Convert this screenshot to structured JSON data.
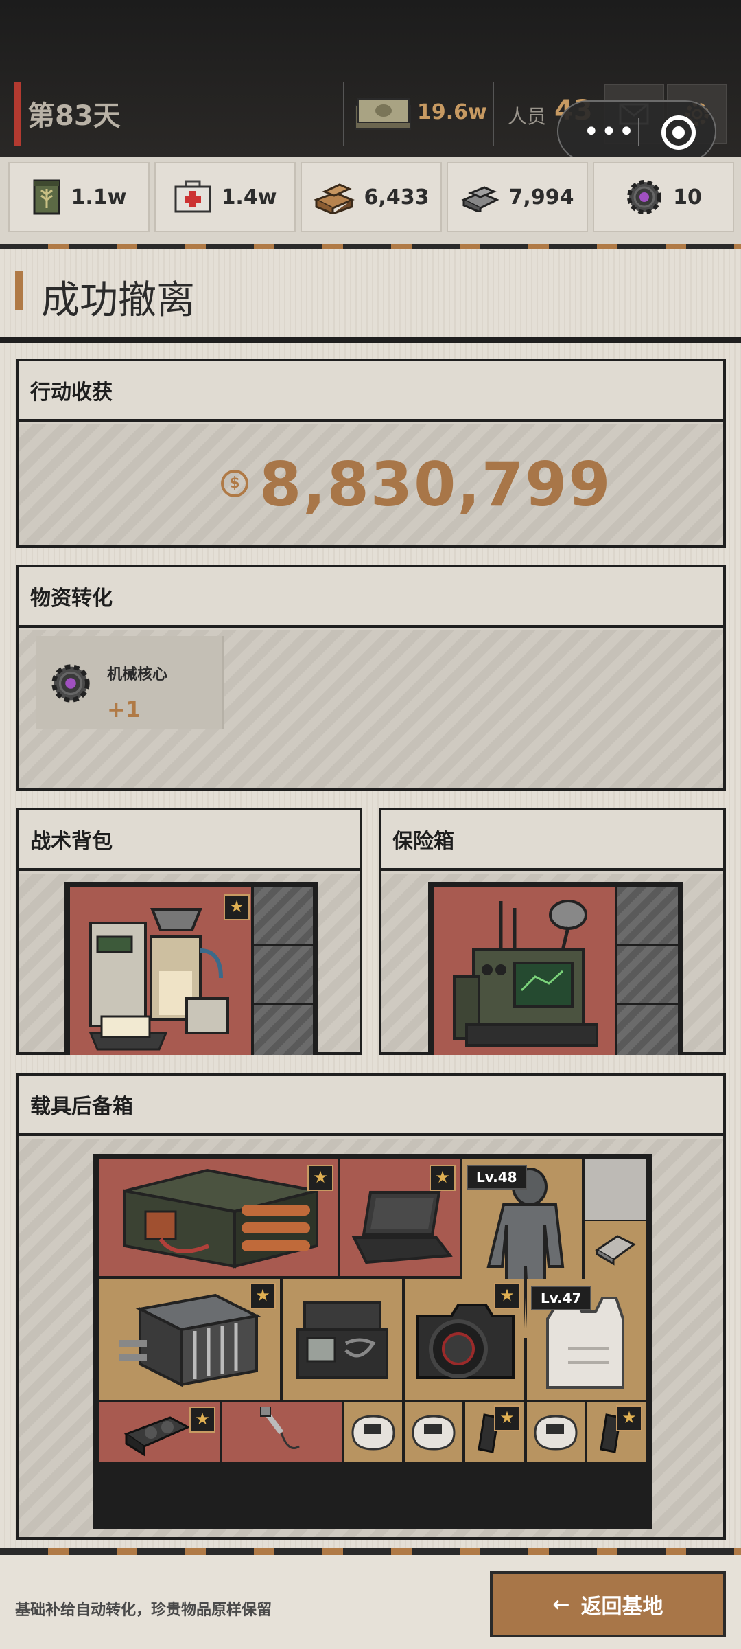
{
  "header": {
    "day": "第83天",
    "money": "19.6w",
    "staff_label": "人员",
    "staff_count": "43"
  },
  "resources": [
    {
      "icon": "grain-can-icon",
      "value": "1.1w"
    },
    {
      "icon": "medkit-icon",
      "value": "1.4w"
    },
    {
      "icon": "wood-planks-icon",
      "value": "6,433"
    },
    {
      "icon": "steel-bars-icon",
      "value": "7,994"
    },
    {
      "icon": "mech-core-icon",
      "value": "10"
    }
  ],
  "page_title": "成功撤离",
  "earnings": {
    "title": "行动收获",
    "currency_symbol": "$",
    "amount": "8,830,799"
  },
  "conversion": {
    "title": "物资转化",
    "item_name": "机械核心",
    "item_delta": "+1"
  },
  "backpack": {
    "title": "战术背包"
  },
  "safe_box": {
    "title": "保险箱"
  },
  "trunk": {
    "title": "载具后备箱",
    "lv_labels": [
      "Lv.48",
      "Lv.47"
    ]
  },
  "footer": {
    "note": "基础补给自动转化，珍贵物品原样保留",
    "return_label": "返回基地",
    "return_arrow": "←"
  },
  "colors": {
    "accent_brown": "#b07a46",
    "accent_red": "#b33a30",
    "cell_red": "#a85a50",
    "cell_tan": "#b89461"
  }
}
